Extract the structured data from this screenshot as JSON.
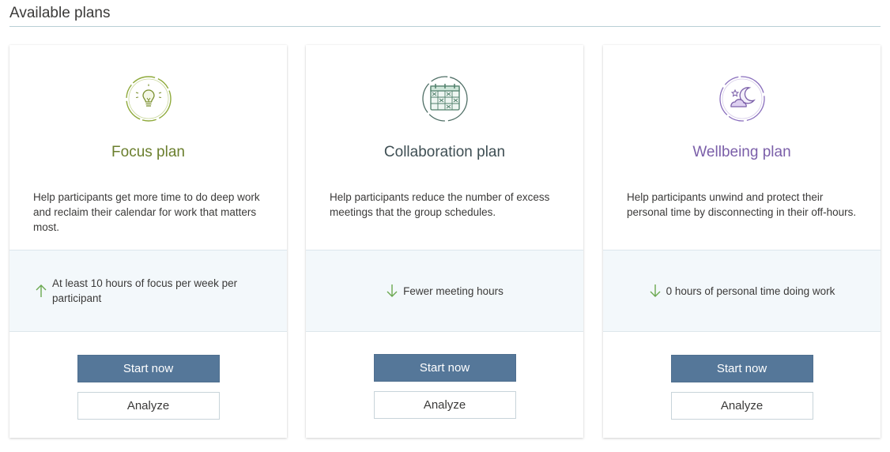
{
  "page": {
    "title": "Available plans"
  },
  "plans": [
    {
      "title": "Focus plan",
      "icon": "lightbulb-icon",
      "title_color": "#6b7f2e",
      "description": "Help participants get more time to do deep work and reclaim their calendar for work that matters most.",
      "metric_direction": "up",
      "metric_text": "At least 10 hours of focus per week per participant",
      "start_label": "Start now",
      "analyze_label": "Analyze"
    },
    {
      "title": "Collaboration plan",
      "icon": "calendar-icon",
      "title_color": "#3f4f54",
      "description": "Help participants reduce the number of excess meetings that the group schedules.",
      "metric_direction": "down",
      "metric_text": "Fewer meeting hours",
      "start_label": "Start now",
      "analyze_label": "Analyze"
    },
    {
      "title": "Wellbeing plan",
      "icon": "moon-cloud-icon",
      "title_color": "#7b5fa9",
      "description": "Help participants unwind and protect their personal time by disconnecting in their off-hours.",
      "metric_direction": "down",
      "metric_text": "0 hours of personal time doing work",
      "start_label": "Start now",
      "analyze_label": "Analyze"
    }
  ],
  "colors": {
    "primary_button": "#557799",
    "metric_background": "#f3f8fb",
    "arrow_green": "#6aa84f"
  }
}
